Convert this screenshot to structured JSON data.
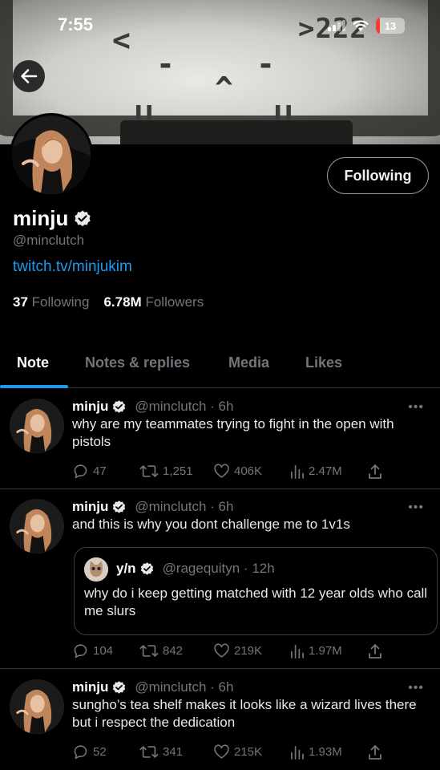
{
  "status_bar": {
    "time": "7:55",
    "battery": "13",
    "battery_level": 0.13
  },
  "banner": {
    "lcd_glyphs": [
      "<",
      "-",
      "-",
      "^",
      "U",
      "U",
      ">222"
    ]
  },
  "profile": {
    "name": "minju",
    "handle": "@minclutch",
    "link": "twitch.tv/minjukim",
    "following_count": "37",
    "following_label": "Following",
    "followers_count": "6.78M",
    "followers_label": "Followers",
    "follow_button": "Following"
  },
  "tabs": [
    {
      "label": "Note",
      "active": true
    },
    {
      "label": "Notes & replies",
      "active": false
    },
    {
      "label": "Media",
      "active": false
    },
    {
      "label": "Likes",
      "active": false
    }
  ],
  "posts": [
    {
      "name": "minju",
      "meta": "@minclutch · 6h",
      "text": "why are my teammates trying to fight in the open with pistols",
      "replies": "47",
      "reposts": "1,251",
      "likes": "406K",
      "views": "2.47M"
    },
    {
      "name": "minju",
      "meta": "@minclutch · 6h",
      "text": "and this is why you dont challenge me to 1v1s",
      "quote": {
        "name": "y/n",
        "meta": "@ragequityn · 12h",
        "text": "why do i keep getting matched with 12 year olds who call me slurs"
      },
      "replies": "104",
      "reposts": "842",
      "likes": "219K",
      "views": "1.97M"
    },
    {
      "name": "minju",
      "meta": "@minclutch · 6h",
      "text": "sungho’s tea shelf makes it looks like a wizard lives there but i respect the dedication",
      "replies": "52",
      "reposts": "341",
      "likes": "215K",
      "views": "1.93M"
    }
  ],
  "icons": {
    "back": "arrow-left-icon",
    "verified": "verified-badge-icon",
    "more": "more-icon",
    "reply": "reply-icon",
    "repost": "repost-icon",
    "like": "heart-icon",
    "views": "views-icon",
    "share": "share-icon"
  },
  "colors": {
    "accent": "#1d9bf0",
    "muted": "#71767b",
    "background": "#000000",
    "text": "#e7e9ea"
  }
}
